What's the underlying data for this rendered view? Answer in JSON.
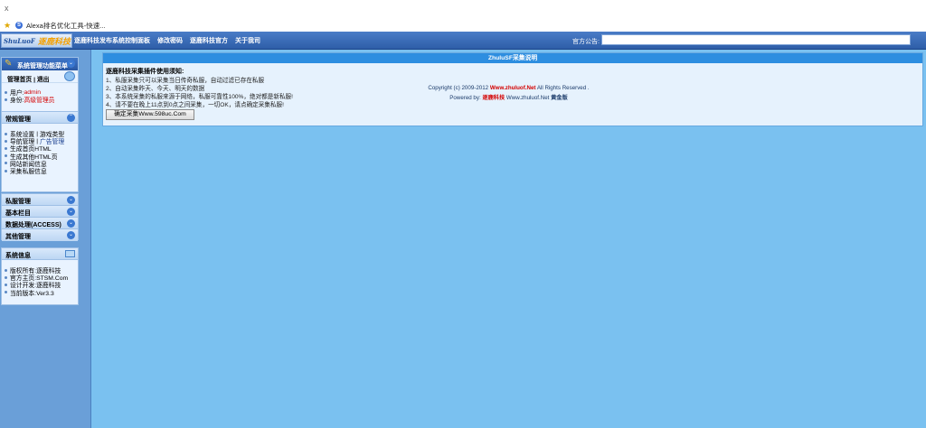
{
  "browser": {
    "close_glyph": "x",
    "tab_title": "Alexa排名优化工具-快速..."
  },
  "topbar": {
    "logo_en": "ShuLuoF",
    "logo_cn": "逐鹿科技",
    "nav": [
      "逐鹿科技发布系统控制面板",
      "修改密码",
      "逐鹿科技官方",
      "关于我司"
    ],
    "notice_label": "官方公告:",
    "notice_value": ""
  },
  "sidebar": {
    "main_title": "系统管理功能菜单",
    "manage_home": "管理首页",
    "sep": "|",
    "logout": "退出",
    "user_label": "用户:",
    "user_value": "admin",
    "role_label": "身份:",
    "role_value": "高级管理员",
    "sections": {
      "common": "常规管理",
      "private": "私服管理",
      "basic": "基本栏目",
      "data": "数据处理(ACCESS)",
      "other": "其他管理"
    },
    "common_items": [
      [
        "系统设置",
        "游戏类型"
      ],
      [
        "导航管理",
        "广告管理"
      ],
      [
        "生成首页HTML"
      ],
      [
        "生成其他HTML页"
      ],
      [
        "网站新闻信息"
      ],
      [
        "采集私服信息"
      ]
    ],
    "sysinfo": {
      "title": "系统信息",
      "items": [
        "版权所有:逐鹿科技",
        "官方主页:STSM.Com",
        "设计开发:逐鹿科技",
        "当前版本:Ver3.3"
      ]
    }
  },
  "main": {
    "panel_title": "ZhuluSF采集说明",
    "heading": "逐鹿科技采集插件使用须知:",
    "lines": [
      "1、私服采集只可以采集当日传奇私服，自动过滤已存在私服",
      "2、自动采集昨天、今天、明天的数据",
      "3、本系统采集的私服来源于网络，私服可靠性100%，绝对都是新私服!",
      "4、请不要在晚上11点到0点之间采集，一切OK，请点确定采集私服!"
    ],
    "confirm_button": "确定采集Www.598uc.Com"
  },
  "footer": {
    "copyright_pre": "Copyright (c) 2009-2012",
    "copyright_site": "Www.zhuluof.Net",
    "copyright_post": "All Rights Reserved .",
    "powered_pre": "Powered by:",
    "powered_brand": "逐鹿科技",
    "powered_site": "Www.zhuluof.Net",
    "powered_edition": "黄金版"
  },
  "colors": {
    "topbar": "#2e5ea8",
    "main_bg": "#7ac1f0",
    "sidebar_bg": "#6a9fd8",
    "accent_red": "#d40000"
  }
}
